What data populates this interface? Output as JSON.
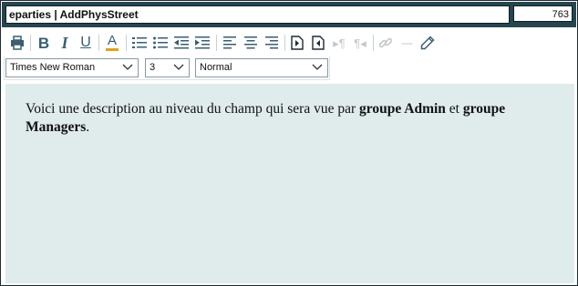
{
  "header": {
    "title": "eparties | AddPhysStreet",
    "count": "763"
  },
  "toolbar": {
    "buttons": [
      {
        "name": "print-icon"
      },
      {
        "name": "bold-icon",
        "glyph": "B"
      },
      {
        "name": "italic-icon",
        "glyph": "I"
      },
      {
        "name": "underline-icon",
        "glyph": "U"
      },
      {
        "name": "font-color-icon",
        "glyph": "A",
        "color": "#e0a020"
      },
      {
        "name": "ordered-list-icon"
      },
      {
        "name": "unordered-list-icon"
      },
      {
        "name": "outdent-icon"
      },
      {
        "name": "indent-icon"
      },
      {
        "name": "align-left-icon"
      },
      {
        "name": "align-center-icon"
      },
      {
        "name": "align-right-icon"
      },
      {
        "name": "insert-field-icon"
      },
      {
        "name": "insert-field-back-icon"
      },
      {
        "name": "ltr-icon",
        "disabled": true
      },
      {
        "name": "rtl-icon",
        "disabled": true
      },
      {
        "name": "link-icon",
        "disabled": true
      },
      {
        "name": "horizontal-rule-icon",
        "disabled": true
      },
      {
        "name": "pencil-icon"
      }
    ]
  },
  "font_select": {
    "value": "Times New Roman"
  },
  "size_select": {
    "value": "3"
  },
  "format_select": {
    "value": "Normal"
  },
  "editor": {
    "text_1": "Voici une description au niveau du champ qui sera vue par ",
    "bold_1": "groupe Admin",
    "text_2": " et ",
    "bold_2": "groupe Managers",
    "text_3": "."
  },
  "colors": {
    "header_bg": "#26464f",
    "editor_bg": "#e0ecec",
    "icon": "#3a5e73",
    "icon_disabled": "#c2c8cc"
  }
}
